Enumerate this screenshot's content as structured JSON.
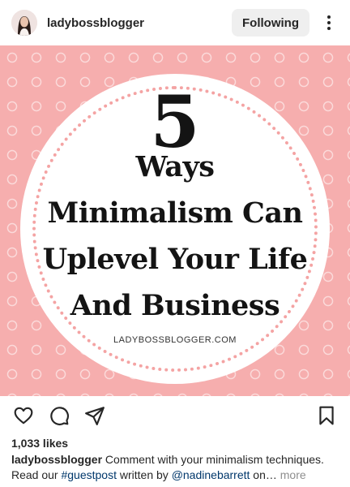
{
  "header": {
    "username": "ladybossblogger",
    "follow_label": "Following"
  },
  "post": {
    "title_number": "5",
    "title_lines": [
      "Ways",
      "Minimalism Can",
      "Uplevel Your Life",
      "And Business"
    ],
    "site": "LADYBOSSBLOGGER.COM",
    "colors": {
      "background": "#f6aeae",
      "dots": "#f4a3a3",
      "text": "#141414"
    }
  },
  "actions": {
    "icons": [
      "heart-icon",
      "comment-icon",
      "share-icon",
      "bookmark-icon"
    ]
  },
  "likes": "1,033 likes",
  "caption": {
    "username": "ladybossblogger",
    "text_1": "Comment with your minimalism techniques.",
    "text_2": "Read our",
    "hashtag": "#guestpost",
    "text_3": "written by",
    "mention": "@nadinebarrett",
    "text_4": "on…",
    "more": "more"
  }
}
